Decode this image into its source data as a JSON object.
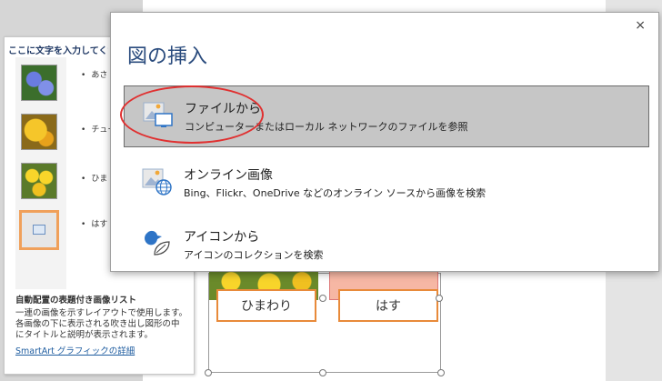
{
  "text_pane": {
    "header": "ここに文字を入力してくだ",
    "bullets": [
      "あさ",
      "チュー",
      "ひま",
      "はす"
    ],
    "footer_title": "自動配置の表題付き画像リスト",
    "footer_lines": [
      "一連の画像を示すレイアウトで使用します。",
      "各画像の下に表示される吹き出し図形の中",
      "にタイトルと説明が表示されます。"
    ],
    "footer_link": "SmartArt グラフィックの詳細"
  },
  "smartart": {
    "labels": [
      "ひまわり",
      "はす"
    ]
  },
  "dialog": {
    "title": "図の挿入",
    "close": "×",
    "options": [
      {
        "title": "ファイルから",
        "desc": "コンピューターまたはローカル ネットワークのファイルを参照",
        "icon": "file-picture-icon"
      },
      {
        "title": "オンライン画像",
        "desc": "Bing、Flickr、OneDrive などのオンライン ソースから画像を検索",
        "icon": "online-picture-icon"
      },
      {
        "title": "アイコンから",
        "desc": "アイコンのコレクションを検索",
        "icon": "icons-bird-icon"
      }
    ]
  },
  "colors": {
    "accent": "#2b4c7e",
    "selection": "#c6c6c6",
    "highlight_ring": "#e03030",
    "smartart_border": "#e88a3a"
  }
}
